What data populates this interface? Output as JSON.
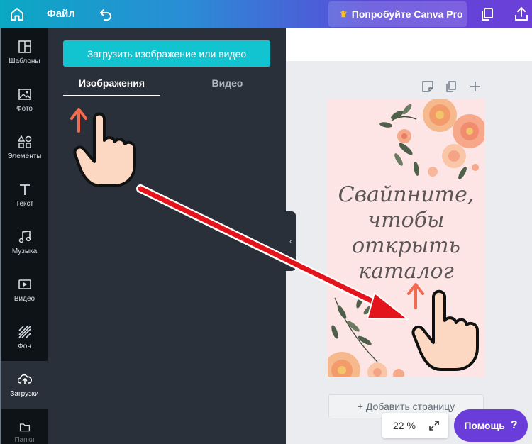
{
  "topbar": {
    "file_label": "Файл",
    "pro_label": "Попробуйте Canva Pro",
    "crown_icon": "♛"
  },
  "rail": [
    {
      "label": "Шаблоны",
      "icon": "templates-icon"
    },
    {
      "label": "Фото",
      "icon": "photo-icon"
    },
    {
      "label": "Элементы",
      "icon": "elements-icon"
    },
    {
      "label": "Текст",
      "icon": "text-icon"
    },
    {
      "label": "Музыка",
      "icon": "music-icon"
    },
    {
      "label": "Видео",
      "icon": "video-icon"
    },
    {
      "label": "Фон",
      "icon": "background-icon"
    },
    {
      "label": "Загрузки",
      "icon": "upload-cloud-icon",
      "active": true
    },
    {
      "label": "Папки",
      "icon": "folder-icon"
    }
  ],
  "panel": {
    "upload_button": "Загрузить изображение или видео",
    "tabs": [
      {
        "label": "Изображения",
        "active": true
      },
      {
        "label": "Видео",
        "active": false
      }
    ]
  },
  "canvas": {
    "design_text_lines": [
      "Свайпните,",
      "чтобы",
      "открыть",
      "каталог"
    ],
    "add_page_label": "+ Добавить страницу",
    "zoom_label": "22 %"
  },
  "help": {
    "label": "Помощь",
    "q": "?"
  },
  "colors": {
    "accent_teal": "#12c4cf",
    "help_purple": "#6a3ddb",
    "annotation_red": "#e3141b",
    "swipe_orange": "#f26a4f"
  }
}
